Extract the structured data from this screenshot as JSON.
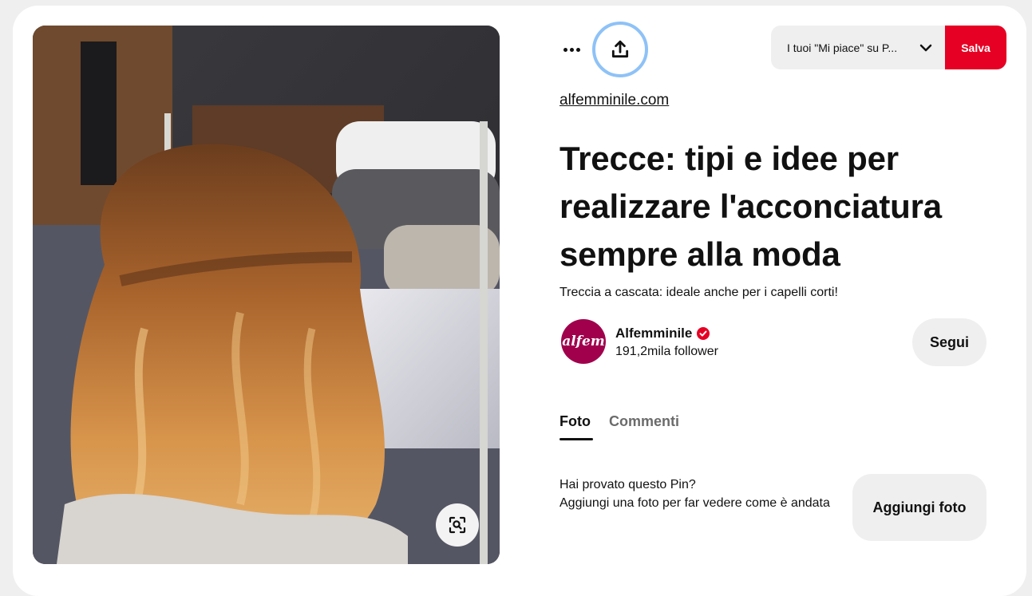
{
  "toolbar": {
    "more_icon": "ellipsis-icon",
    "share_icon": "share-upload-icon",
    "board_select_label": "I tuoi \"Mi piace\" su P...",
    "save_label": "Salva",
    "save_color": "#e60023"
  },
  "pin": {
    "image_alt": "Treccia a cascata su capelli ondulati",
    "visual_search_icon": "visual-search-icon",
    "source": "alfemminile.com",
    "title": "Trecce: tipi e idee per realizzare l'acconciatura sempre alla moda",
    "description": "Treccia a cascata: ideale anche per i capelli corti!"
  },
  "creator": {
    "avatar_text": "alfem",
    "avatar_color": "#a0004c",
    "name": "Alfemminile",
    "verified_icon": "verified-badge-icon",
    "followers": "191,2mila follower",
    "follow_label": "Segui"
  },
  "tabs": [
    {
      "label": "Foto",
      "active": true
    },
    {
      "label": "Commenti",
      "active": false
    }
  ],
  "tried": {
    "line1": "Hai provato questo Pin?",
    "line2": "Aggiungi una foto per far vedere come è andata",
    "button_label": "Aggiungi foto"
  }
}
